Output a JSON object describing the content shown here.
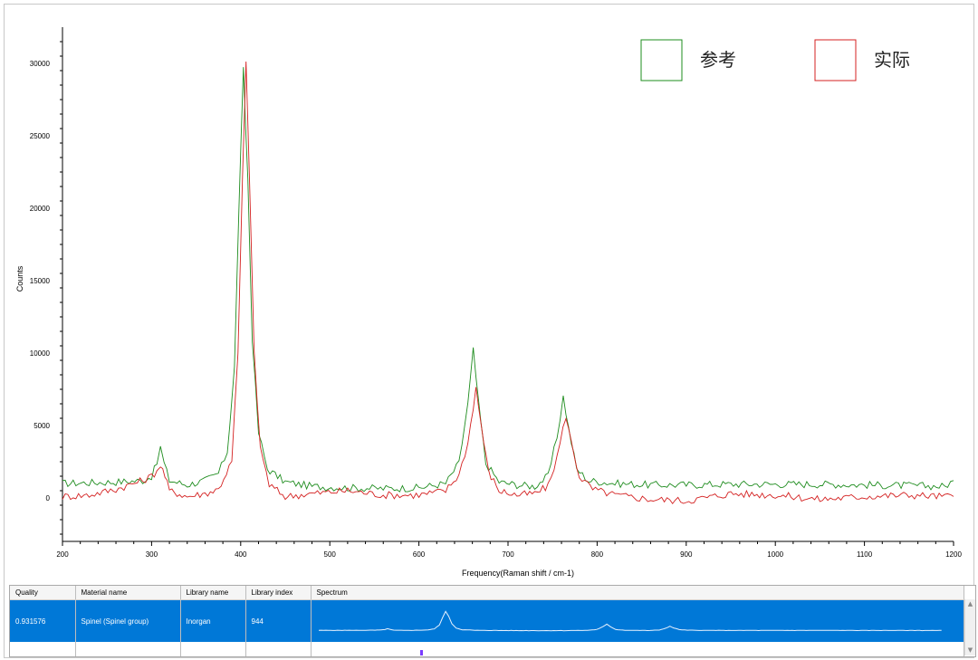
{
  "chart_data": {
    "type": "line",
    "xlabel": "Frequency(Raman shift / cm-1)",
    "ylabel": "Counts",
    "xlim": [
      200,
      1200
    ],
    "ylim": [
      -3000,
      32500
    ],
    "x_ticks": [
      200,
      300,
      400,
      500,
      600,
      700,
      800,
      900,
      1000,
      1100,
      1200
    ],
    "y_ticks": [
      0,
      5000,
      10000,
      15000,
      20000,
      25000,
      30000
    ],
    "grid": false,
    "legend_position": "top-right",
    "series": [
      {
        "name": "参考",
        "color": "#1e8c1e",
        "points": [
          [
            200,
            1000
          ],
          [
            230,
            1050
          ],
          [
            260,
            1100
          ],
          [
            290,
            1200
          ],
          [
            300,
            1500
          ],
          [
            306,
            2400
          ],
          [
            310,
            3500
          ],
          [
            314,
            2400
          ],
          [
            320,
            1200
          ],
          [
            340,
            900
          ],
          [
            360,
            1200
          ],
          [
            375,
            1700
          ],
          [
            385,
            3200
          ],
          [
            393,
            9000
          ],
          [
            398,
            20000
          ],
          [
            403,
            29500
          ],
          [
            408,
            22000
          ],
          [
            413,
            11000
          ],
          [
            420,
            4500
          ],
          [
            430,
            2000
          ],
          [
            450,
            1100
          ],
          [
            480,
            800
          ],
          [
            520,
            700
          ],
          [
            560,
            650
          ],
          [
            600,
            700
          ],
          [
            630,
            1000
          ],
          [
            645,
            2400
          ],
          [
            655,
            6500
          ],
          [
            661,
            10200
          ],
          [
            667,
            6500
          ],
          [
            675,
            2400
          ],
          [
            690,
            1100
          ],
          [
            710,
            900
          ],
          [
            730,
            800
          ],
          [
            745,
            1500
          ],
          [
            755,
            4200
          ],
          [
            762,
            7000
          ],
          [
            768,
            4800
          ],
          [
            777,
            2000
          ],
          [
            790,
            1200
          ],
          [
            820,
            1000
          ],
          [
            860,
            900
          ],
          [
            900,
            900
          ],
          [
            950,
            950
          ],
          [
            1000,
            950
          ],
          [
            1050,
            950
          ],
          [
            1100,
            900
          ],
          [
            1150,
            850
          ],
          [
            1190,
            800
          ],
          [
            1200,
            1200
          ]
        ]
      },
      {
        "name": "实际",
        "color": "#d42020",
        "points": [
          [
            200,
            100
          ],
          [
            230,
            200
          ],
          [
            260,
            600
          ],
          [
            290,
            1200
          ],
          [
            300,
            1500
          ],
          [
            306,
            1900
          ],
          [
            310,
            2300
          ],
          [
            315,
            1500
          ],
          [
            320,
            500
          ],
          [
            340,
            100
          ],
          [
            360,
            300
          ],
          [
            375,
            600
          ],
          [
            390,
            2500
          ],
          [
            397,
            10000
          ],
          [
            402,
            22000
          ],
          [
            406,
            30000
          ],
          [
            410,
            22000
          ],
          [
            415,
            10000
          ],
          [
            422,
            3500
          ],
          [
            432,
            900
          ],
          [
            450,
            100
          ],
          [
            480,
            300
          ],
          [
            520,
            500
          ],
          [
            560,
            200
          ],
          [
            600,
            200
          ],
          [
            630,
            500
          ],
          [
            645,
            1600
          ],
          [
            655,
            3800
          ],
          [
            664,
            7600
          ],
          [
            670,
            5000
          ],
          [
            678,
            1800
          ],
          [
            690,
            500
          ],
          [
            710,
            200
          ],
          [
            730,
            300
          ],
          [
            745,
            800
          ],
          [
            755,
            2800
          ],
          [
            765,
            5700
          ],
          [
            771,
            3800
          ],
          [
            780,
            1500
          ],
          [
            795,
            600
          ],
          [
            820,
            200
          ],
          [
            860,
            -100
          ],
          [
            900,
            -200
          ],
          [
            950,
            300
          ],
          [
            1000,
            200
          ],
          [
            1050,
            -100
          ],
          [
            1100,
            100
          ],
          [
            1150,
            200
          ],
          [
            1190,
            100
          ],
          [
            1200,
            100
          ]
        ]
      }
    ]
  },
  "legend": {
    "reference_label": "参考",
    "actual_label": "实际"
  },
  "results_table": {
    "headers": {
      "quality": "Quality",
      "material_name": "Material name",
      "library_name": "Library name",
      "library_index": "Library index",
      "spectrum": "Spectrum"
    },
    "selected_row": {
      "quality": "0.931576",
      "material_name": "Spinel (Spinel group)",
      "library_name": "Inorgan",
      "library_index": "944"
    }
  },
  "colors": {
    "selection": "#0078d7",
    "reference_series": "#1e8c1e",
    "actual_series": "#d42020"
  },
  "icons": {
    "scroll_up": "▲",
    "scroll_down": "▼"
  }
}
